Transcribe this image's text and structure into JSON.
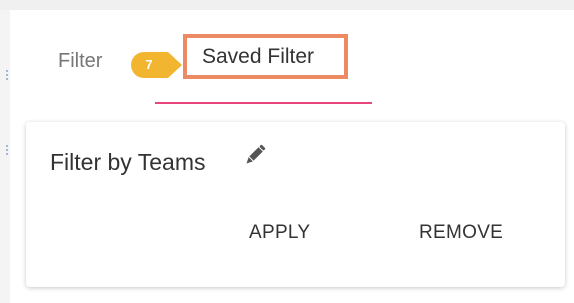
{
  "tabs": {
    "filter_label": "Filter",
    "saved_filter_label": "Saved Filter",
    "step_badge": "7"
  },
  "card": {
    "title": "Filter by Teams",
    "edit_icon": "pencil-icon",
    "apply_label": "APPLY",
    "remove_label": "REMOVE"
  },
  "colors": {
    "highlight_border": "#ec8a63",
    "badge": "#f2b52f",
    "active_underline": "#e8467c"
  }
}
